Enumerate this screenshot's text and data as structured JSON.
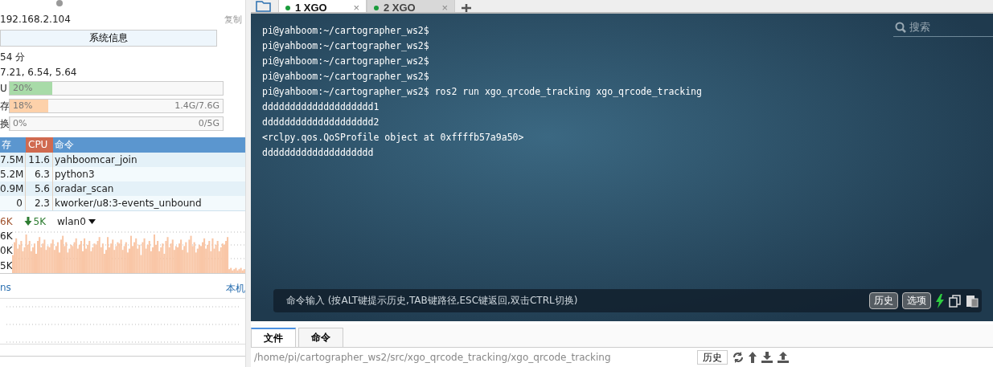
{
  "sidebar": {
    "ip": "192.168.2.104",
    "copy": "复制",
    "sysinfo_button": "系统信息",
    "uptime": "54 分",
    "load": "7.21, 6.54, 5.64",
    "meters": [
      {
        "label": "U",
        "percent": "20%",
        "level": 0.2,
        "color": "#a8dba8"
      },
      {
        "label": "存",
        "percent": "18%",
        "detail": "1.4G/7.6G",
        "level": 0.18,
        "color": "#fdd1aa"
      },
      {
        "label": "换",
        "percent": "0%",
        "detail": "0/5G",
        "level": 0
      }
    ],
    "process_table": {
      "columns": [
        "存",
        "CPU",
        "命令"
      ],
      "rows": [
        {
          "mem": "7.5M",
          "cpu": "11.6",
          "cmd": "yahboomcar_join"
        },
        {
          "mem": "5.2M",
          "cpu": "6.3",
          "cmd": "python3"
        },
        {
          "mem": "0.9M",
          "cpu": "5.6",
          "cmd": "oradar_scan"
        },
        {
          "mem": "0",
          "cpu": "2.3",
          "cmd": "kworker/u8:3-events_unbound"
        }
      ]
    },
    "network": {
      "up": "6K",
      "down": "5K",
      "interface": "wlan0",
      "ylabels": [
        "6K",
        "0K",
        "5K"
      ]
    },
    "latency": {
      "label": "ns",
      "host": "本机"
    }
  },
  "tabs": [
    {
      "label": "1 XGO",
      "close": "×",
      "selected": true
    },
    {
      "label": "2 XGO",
      "close": "×",
      "selected": false
    }
  ],
  "terminal": {
    "search_placeholder": "搜索",
    "lines": [
      "pi@yahboom:~/cartographer_ws2$",
      "pi@yahboom:~/cartographer_ws2$",
      "pi@yahboom:~/cartographer_ws2$",
      "pi@yahboom:~/cartographer_ws2$",
      "pi@yahboom:~/cartographer_ws2$ ros2 run xgo_qrcode_tracking xgo_qrcode_tracking",
      "dddddddddddddddddddd1",
      "dddddddddddddddddddd2",
      "<rclpy.qos.QoSProfile object at 0xffffb57a9a50>",
      "dddddddddddddddddddd"
    ],
    "command_placeholder": "命令输入 (按ALT键提示历史,TAB键路径,ESC键返回,双击CTRL切换)",
    "history_button": "历史",
    "options_button": "选项"
  },
  "bottom_tabs": [
    {
      "label": "文件",
      "selected": true
    },
    {
      "label": "命令",
      "selected": false
    }
  ],
  "file_bar": {
    "path": "/home/pi/cartographer_ws2/src/xgo_qrcode_tracking/xgo_qrcode_tracking",
    "history_button": "历史"
  }
}
